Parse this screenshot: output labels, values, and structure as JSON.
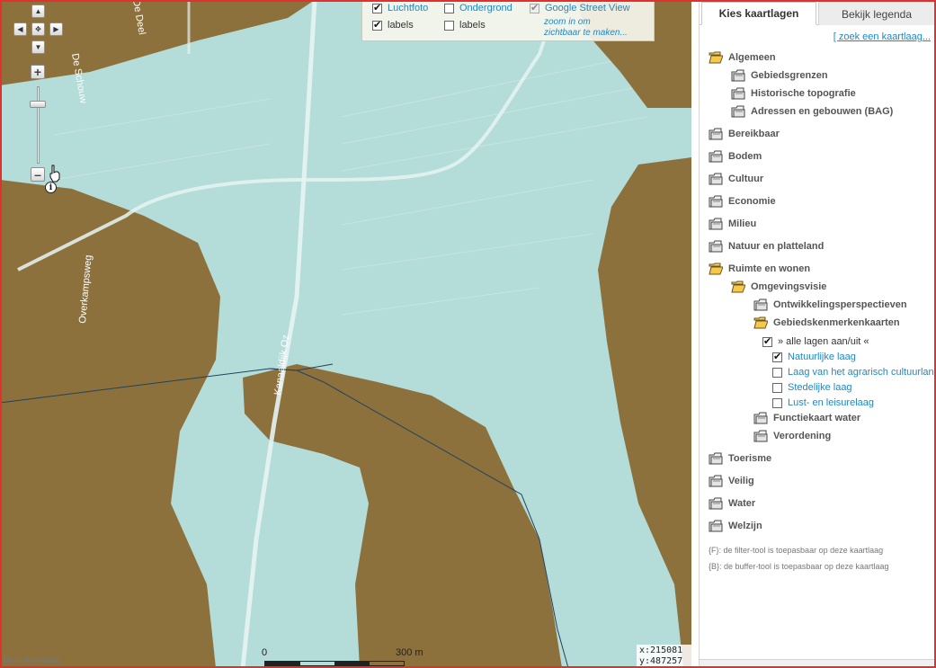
{
  "map": {
    "roads": {
      "top_left_road": "De Schouw",
      "top_road2": "De Deel",
      "left_road": "Overkampsweg",
      "main_road": "Kanaaldijk Oz"
    },
    "layers": {
      "luchtfoto": {
        "label": "Luchtfoto",
        "checked": true
      },
      "labels1": {
        "label": "labels",
        "checked": true
      },
      "ondergrond": {
        "label": "Ondergrond",
        "checked": false
      },
      "labels2": {
        "label": "labels",
        "checked": false
      },
      "streetview": {
        "label": "Google Street View",
        "checked": true,
        "note": "zoom in om\nzichtbaar te maken..."
      }
    },
    "scale": {
      "start": "0",
      "end": "300 m"
    },
    "coords": {
      "x": "x:215081",
      "y": "y:487257"
    },
    "attribution": "bron Aerodata",
    "colors": {
      "water_layer": "#b0dcd8",
      "nature_layer": "#8a6a35"
    }
  },
  "panel": {
    "tabs": [
      {
        "label": "Kies kaartlagen",
        "active": true
      },
      {
        "label": "Bekijk legenda",
        "active": false
      }
    ],
    "search_link": "zoek een kaartlaag...",
    "tree": [
      {
        "id": "algemeen",
        "label": "Algemeen",
        "open": true
      },
      {
        "id": "gebiedsgrenzen",
        "label": "Gebiedsgrenzen",
        "open": false
      },
      {
        "id": "historische",
        "label": "Historische topografie",
        "open": false
      },
      {
        "id": "adressen",
        "label": "Adressen en gebouwen (BAG)",
        "open": false
      },
      {
        "id": "bereikbaar",
        "label": "Bereikbaar",
        "open": false
      },
      {
        "id": "bodem",
        "label": "Bodem",
        "open": false
      },
      {
        "id": "cultuur",
        "label": "Cultuur",
        "open": false
      },
      {
        "id": "economie",
        "label": "Economie",
        "open": false
      },
      {
        "id": "milieu",
        "label": "Milieu",
        "open": false
      },
      {
        "id": "natuur",
        "label": "Natuur en platteland",
        "open": false
      },
      {
        "id": "ruimte",
        "label": "Ruimte en wonen",
        "open": true
      },
      {
        "id": "omgevingsvisie",
        "label": "Omgevingsvisie",
        "open": true
      },
      {
        "id": "ontwikkeling",
        "label": "Ontwikkelingsperspectieven",
        "open": false
      },
      {
        "id": "gebiedskenmerken",
        "label": "Gebiedskenmerkenkaarten",
        "open": true
      },
      {
        "id": "functiekaart",
        "label": "Functiekaart water",
        "open": false
      },
      {
        "id": "verordening",
        "label": "Verordening",
        "open": false
      },
      {
        "id": "toerisme",
        "label": "Toerisme",
        "open": false
      },
      {
        "id": "veilig",
        "label": "Veilig",
        "open": false
      },
      {
        "id": "water",
        "label": "Water",
        "open": false
      },
      {
        "id": "welzijn",
        "label": "Welzijn",
        "open": false
      }
    ],
    "sublayers": [
      {
        "label": "» alle lagen aan/uit «",
        "checked": true
      },
      {
        "label": "Natuurlijke laag",
        "checked": true
      },
      {
        "label": "Laag van het agrarisch cultuurlandschap",
        "checked": false
      },
      {
        "label": "Stedelijke laag",
        "checked": false
      },
      {
        "label": "Lust- en leisurelaag",
        "checked": false
      }
    ],
    "notes": [
      "{F}: de filter-tool is toepasbaar op deze kaartlaag",
      "{B}: de buffer-tool is toepasbaar op deze kaartlaag"
    ]
  }
}
